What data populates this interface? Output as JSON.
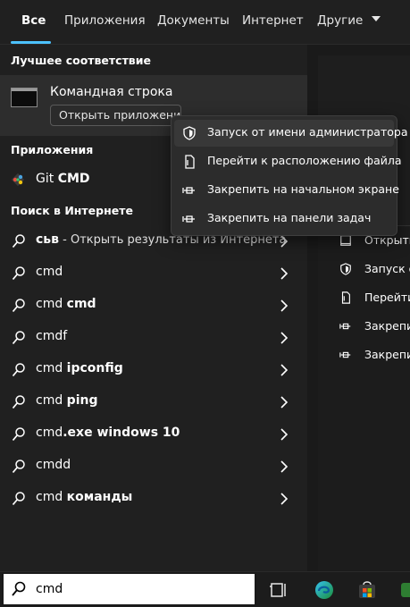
{
  "tabs": [
    {
      "label": "Все"
    },
    {
      "label": "Приложения"
    },
    {
      "label": "Документы"
    },
    {
      "label": "Интернет"
    },
    {
      "label": "Другие",
      "icon": "chevron-down-icon"
    }
  ],
  "best_match": {
    "section_title": "Лучшее соответствие",
    "title": "Командная строка",
    "open_button": "Открыть приложение"
  },
  "apps": {
    "section_title": "Приложения",
    "items": [
      {
        "name_regular": "Git ",
        "name_bold": "CMD",
        "icon": "git-icon"
      }
    ]
  },
  "web": {
    "section_title": "Поиск в Интернете",
    "items": [
      {
        "regular": "",
        "bold": "сьв",
        "suffix": " - Открыть результаты из Интернета"
      },
      {
        "regular": "cmd",
        "bold": "",
        "suffix": ""
      },
      {
        "regular": "cmd ",
        "bold": "cmd",
        "suffix": ""
      },
      {
        "regular": "cmdf",
        "bold": "",
        "suffix": ""
      },
      {
        "regular": "cmd ",
        "bold": "ipconfig",
        "suffix": ""
      },
      {
        "regular": "cmd ",
        "bold": "ping",
        "suffix": ""
      },
      {
        "regular": "cmd",
        "bold": ".exe windows 10",
        "suffix": ""
      },
      {
        "regular": "cmdd",
        "bold": "",
        "suffix": ""
      },
      {
        "regular": "cmd ",
        "bold": "команды",
        "suffix": ""
      }
    ]
  },
  "right_pane": {
    "items": [
      {
        "label": "Открыть",
        "icon": "open-icon"
      },
      {
        "label": "Запуск о",
        "icon": "shield-icon"
      },
      {
        "label": "Перейти",
        "icon": "file-location-icon"
      },
      {
        "label": "Закрепит",
        "icon": "pin-icon"
      },
      {
        "label": "Закрепит",
        "icon": "pin-icon"
      }
    ]
  },
  "context_menu": {
    "items": [
      {
        "label": "Запуск от имени администратора",
        "icon": "shield-icon"
      },
      {
        "label": "Перейти к расположению файла",
        "icon": "file-location-icon"
      },
      {
        "label": "Закрепить на начальном экране",
        "icon": "pin-icon"
      },
      {
        "label": "Закрепить на панели задач",
        "icon": "pin-icon"
      }
    ]
  },
  "taskbar": {
    "search_value": "cmd",
    "icons": [
      "task-view-icon",
      "edge-icon",
      "store-icon",
      "app-icon"
    ]
  },
  "colors": {
    "accent": "#4cc2ff",
    "background": "#202020",
    "highlight": "#2d2d2d"
  }
}
